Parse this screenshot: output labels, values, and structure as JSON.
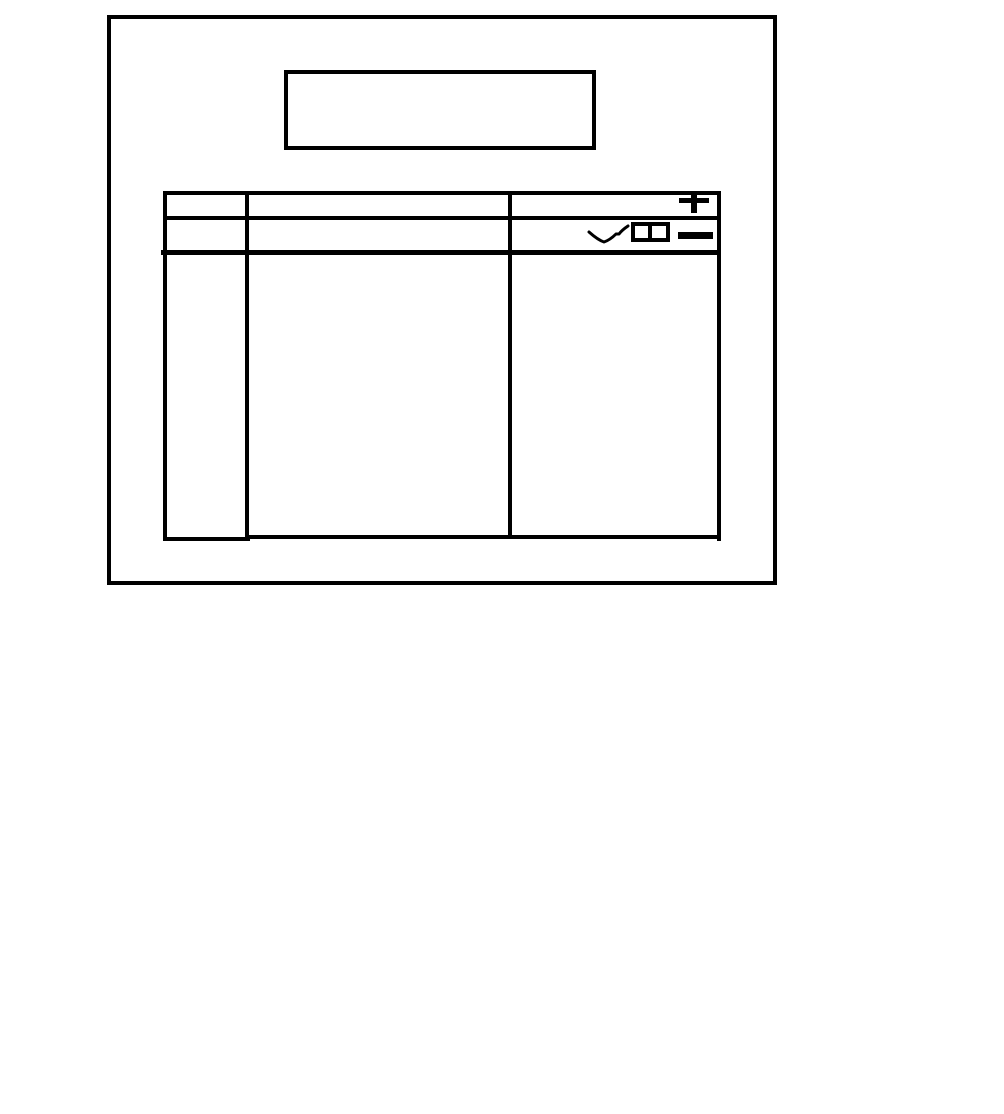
{
  "title_box": {
    "text": ""
  },
  "table": {
    "header_cells": [
      "",
      "",
      ""
    ],
    "second_row_cells": [
      "",
      "",
      ""
    ]
  },
  "icons": {
    "add": "plus-icon",
    "remove": "minus-icon",
    "check": "checkmark-icon",
    "columns": "split-columns-icon"
  },
  "colors": {
    "stroke": "#000000",
    "background": "#ffffff"
  }
}
